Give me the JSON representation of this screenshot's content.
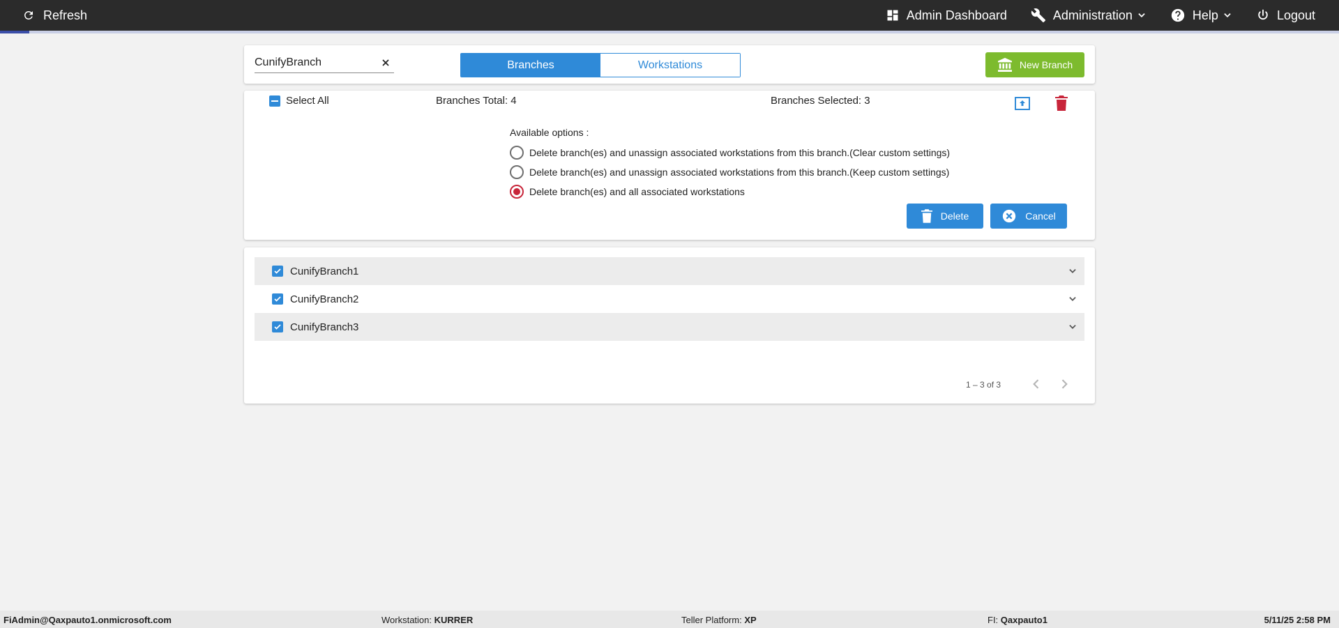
{
  "topbar": {
    "refresh_label": "Refresh",
    "admin_dashboard_label": "Admin Dashboard",
    "administration_label": "Administration",
    "help_label": "Help",
    "logout_label": "Logout",
    "progress_fraction": 0.022
  },
  "search": {
    "value": "CunifyBranch",
    "placeholder": ""
  },
  "tabs": {
    "branches_label": "Branches",
    "workstations_label": "Workstations",
    "active": "Branches"
  },
  "new_branch_label": "New Branch",
  "summary": {
    "select_all_label": "Select All",
    "branches_total_text": "Branches Total: 4",
    "branches_selected_text": "Branches Selected: 3"
  },
  "options": {
    "heading": "Available options :",
    "items": [
      {
        "label": "Delete branch(es) and unassign associated workstations from this branch.(Clear custom settings)",
        "checked": false
      },
      {
        "label": "Delete branch(es) and unassign associated workstations from this branch.(Keep custom settings)",
        "checked": false
      },
      {
        "label": "Delete branch(es) and all associated workstations",
        "checked": true
      }
    ],
    "delete_label": "Delete",
    "cancel_label": "Cancel"
  },
  "branches": [
    {
      "name": "CunifyBranch1",
      "checked": true
    },
    {
      "name": "CunifyBranch2",
      "checked": true
    },
    {
      "name": "CunifyBranch3",
      "checked": true
    }
  ],
  "pager": {
    "range_text": "1 – 3 of 3"
  },
  "footer": {
    "user": "FiAdmin@Qaxpauto1.onmicrosoft.com",
    "workstation_label": "Workstation:",
    "workstation_value": "KURRER",
    "teller_platform_label": "Teller Platform:",
    "teller_platform_value": "XP",
    "fi_label": "FI:",
    "fi_value": "Qaxpauto1",
    "datetime": "5/11/25 2:58 PM"
  },
  "colors": {
    "primary": "#2f8ad8",
    "success": "#7dbb2e",
    "danger": "#c8253a",
    "topbar": "#2b2b2b"
  }
}
